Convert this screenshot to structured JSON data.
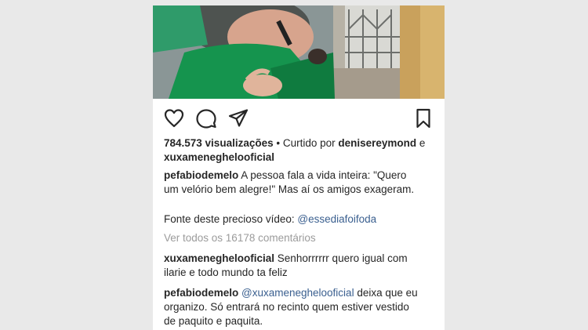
{
  "post": {
    "views": "784.573 visualizações",
    "liked_by_prefix": " • Curtido por ",
    "liked_by_user1": "denisereymond",
    "liked_by_joiner": " e",
    "liked_by_user2": "xuxameneghelooficial",
    "caption": {
      "user": "pefabiodemelo",
      "line1": " A pessoa fala a vida inteira: \"Quero",
      "line2": "um velório bem alegre!\" Mas aí os amigos exageram.",
      "source_label": "Fonte deste precioso vídeo: ",
      "source_link": "@essediafoifoda"
    },
    "view_all_comments": "Ver todos os 16178 comentários",
    "comments": [
      {
        "user": "xuxameneghelooficial",
        "line1": " Senhorrrrrr quero igual com",
        "line2": "ilarie e todo mundo ta feliz"
      },
      {
        "user": "pefabiodemelo",
        "mention": "@xuxameneghelooficial",
        "line1": " deixa que eu",
        "line2": "organizo. Só entrará no recinto quem estiver vestido",
        "line3": "de paquito e paquita."
      }
    ]
  },
  "icons": {
    "like": "heart-icon",
    "comment": "comment-bubble-icon",
    "share": "paper-plane-icon",
    "save": "bookmark-icon"
  },
  "colors": {
    "text": "#262626",
    "muted": "#9b9b9b",
    "link": "#3a5f8f",
    "background": "#e9e9e9"
  }
}
